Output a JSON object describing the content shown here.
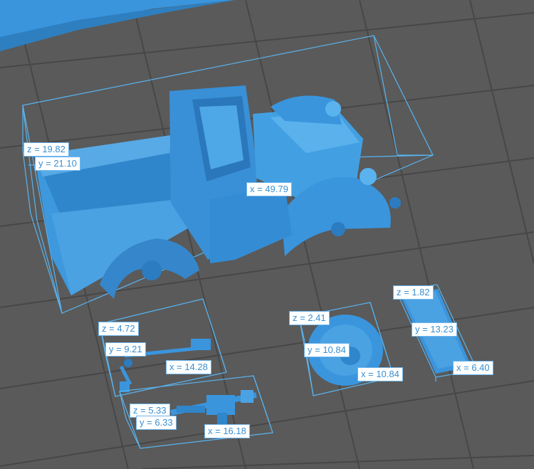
{
  "colors": {
    "plate_background": "#5a5a5a",
    "grid_line": "#444444",
    "model_blue": "#3a95dd",
    "bounding_box": "#58b4f0",
    "label_text": "#3a8fd1"
  },
  "objects": [
    {
      "name": "truck-body",
      "icon": "truck-icon",
      "dimensions": {
        "x": "x = 49.79",
        "y": "y = 21.10",
        "z": "z = 19.82"
      }
    },
    {
      "name": "gun-mount",
      "icon": "gun-mount-icon",
      "dimensions": {
        "x": "x = 14.28",
        "y": "y = 9.21",
        "z": "z = 4.72"
      }
    },
    {
      "name": "machine-gun",
      "icon": "machine-gun-icon",
      "dimensions": {
        "x": "x = 16.18",
        "y": "y = 6.33",
        "z": "z = 5.33"
      }
    },
    {
      "name": "spare-wheel",
      "icon": "wheel-icon",
      "dimensions": {
        "x": "x = 10.84",
        "y": "y = 10.84",
        "z": "z = 2.41"
      }
    },
    {
      "name": "flat-plate",
      "icon": "plate-icon",
      "dimensions": {
        "x": "x = 6.40",
        "y": "y = 13.23",
        "z": "z = 1.82"
      }
    }
  ]
}
